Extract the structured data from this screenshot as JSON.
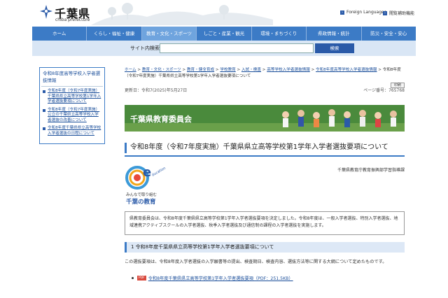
{
  "header": {
    "logo_ja": "千葉県",
    "logo_en": "chiba prefecture",
    "util_links": [
      "Foreign Languages",
      "閲覧補助機能"
    ]
  },
  "gnav": {
    "items": [
      "ホーム",
      "くらし・福祉・健康",
      "教育・文化・スポーツ",
      "しごと・産業・観光",
      "環境・まちづくり",
      "県政情報・統計",
      "防災・安全・安心"
    ],
    "active_index": 2
  },
  "search": {
    "label": "サイト内検索",
    "placeholder": "",
    "button": "検索"
  },
  "sidebar": {
    "title": "令和8年度高等学校入学者選抜情報",
    "items": [
      "令和8年度（令和7年度実施）千葉県県立高等学校第1学年入学者選抜要項について",
      "令和8年度（令和7年度実施）公立の千葉県立高等学校入学者選抜の改善について",
      "令和8年度千葉県県立高等学校入学者選抜の日程について"
    ]
  },
  "breadcrumb": {
    "items": [
      "ホーム",
      "教育・文化・スポーツ",
      "教育・健全育成",
      "学校教育",
      "入試・検査",
      "高等学校入学者選抜情報",
      "令和8年度高等学校入学者選抜情報"
    ],
    "current": "令和8年度（令和7年度実施）千葉県県立高等学校第1学年入学者選抜要項について"
  },
  "meta": {
    "updated": "更新日：令和7(2025)年5月27日",
    "page_no": "ページ番号：765768",
    "print": "印刷"
  },
  "banner": {
    "text": "千葉県教育委員会"
  },
  "page_title": "令和8年度（令和7年度実施）千葉県県立高等学校第1学年入学者選抜要項について",
  "dept": "千葉県教育庁教育振興部学習指導課",
  "edu_logo": {
    "letter": "e",
    "script": "ducation",
    "caption1": "みんなで取り組む",
    "caption2": "千葉の教育"
  },
  "info_text": "県教育委員会は、令和8年度千葉県県立高等学校第1学年入学者選抜要項を決定しました。令和8年度は、一般入学者選抜、特別入学者選抜、地域連携アクティブスクールの入学者選抜、秋季入学者選抜及び通信制の課程の入学者選抜を実施します。",
  "section": {
    "heading": "1 令和8年度千葉県県立高等学校第1学年入学者選抜要項について",
    "text": "この選抜要項は、令和8年度入学者選抜の入学願書等の提出、検査期日、検査内容、選抜方法等に関する大綱について定めたものです。",
    "pdf_badge": "PDF",
    "pdf_link": "令和8年度千葉県県立高等学校第1学年入学者選抜要項（PDF：251.5KB）"
  },
  "colors": {
    "nav_blue": "#3c7bc6",
    "active_nav": "#6fa4de",
    "link": "#1a4e9a",
    "banner_green": "#3f7a34"
  }
}
